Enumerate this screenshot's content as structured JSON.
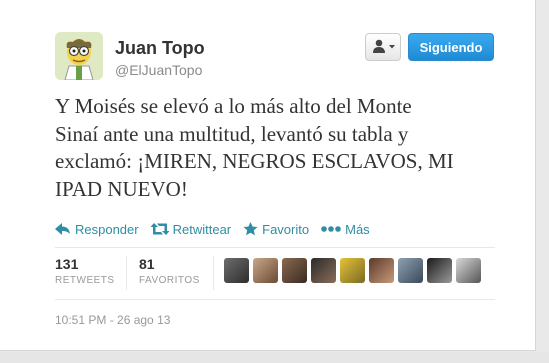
{
  "user": {
    "name": "Juan Topo",
    "handle": "@ElJuanTopo"
  },
  "buttons": {
    "follow_label": "Siguiendo"
  },
  "tweet": {
    "lines": [
      "Y Moisés se elevó a lo más alto del Monte",
      "Sinaí ante una multitud, levantó su tabla y",
      "exclamó: ¡MIREN, NEGROS ESCLAVOS, MI",
      "IPAD NUEVO!"
    ]
  },
  "actions": {
    "reply": "Responder",
    "retweet": "Retwittear",
    "favorite": "Favorito",
    "more": "Más"
  },
  "stats": {
    "retweets_count": "131",
    "retweets_label": "RETWEETS",
    "favorites_count": "81",
    "favorites_label": "FAVORITOS"
  },
  "timestamp": "10:51 PM - 26 ago 13",
  "colors": {
    "link": "#2f8ea2",
    "follow_button": "#2b93dc"
  },
  "icons": [
    "avatar",
    "user-menu-icon",
    "reply-icon",
    "retweet-icon",
    "star-icon",
    "more-icon"
  ]
}
